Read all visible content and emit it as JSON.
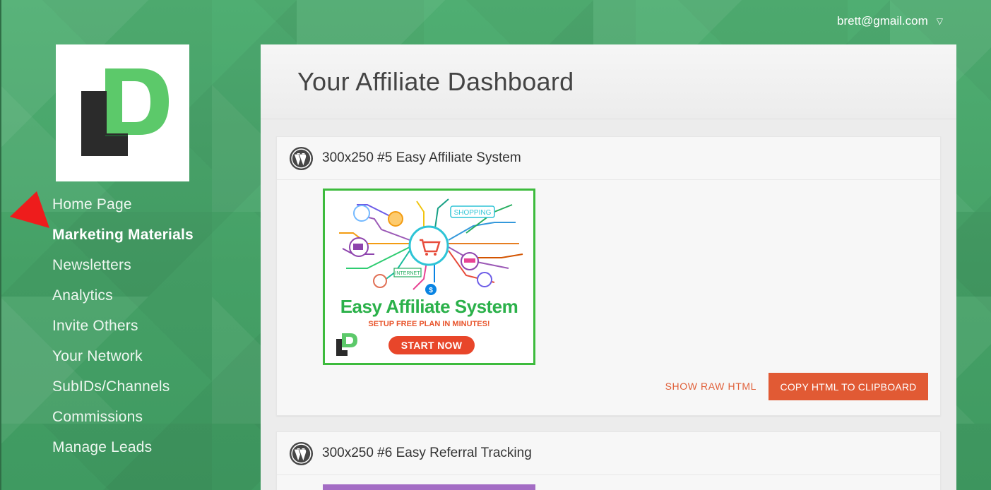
{
  "account": {
    "email": "brett@gmail.com",
    "caret": "▽"
  },
  "nav": [
    {
      "label": "Home Page"
    },
    {
      "label": "Marketing Materials"
    },
    {
      "label": "Newsletters"
    },
    {
      "label": "Analytics"
    },
    {
      "label": "Invite Others"
    },
    {
      "label": "Your Network"
    },
    {
      "label": "SubIDs/Channels"
    },
    {
      "label": "Commissions"
    },
    {
      "label": "Manage Leads"
    }
  ],
  "page": {
    "title": "Your Affiliate Dashboard"
  },
  "cards": [
    {
      "title": "300x250 #5 Easy Affiliate System",
      "banner": {
        "shopping": "SHOPPING",
        "internet": "INTERNET",
        "headline": "Easy Affiliate System",
        "subline": "SETUP FREE PLAN IN MINUTES!",
        "button": "START NOW"
      },
      "show_raw": "SHOW RAW HTML",
      "copy": "COPY HTML TO CLIPBOARD"
    },
    {
      "title": "300x250 #6 Easy Referral Tracking"
    }
  ],
  "colors": {
    "accent": "#e15a34",
    "bg_green": "#4aa46d",
    "logo_green": "#5cc96a"
  },
  "icons": [
    "wordpress-icon",
    "pointer-arrow-icon",
    "cart-icon",
    "dollar-icon",
    "caret-down-icon"
  ]
}
